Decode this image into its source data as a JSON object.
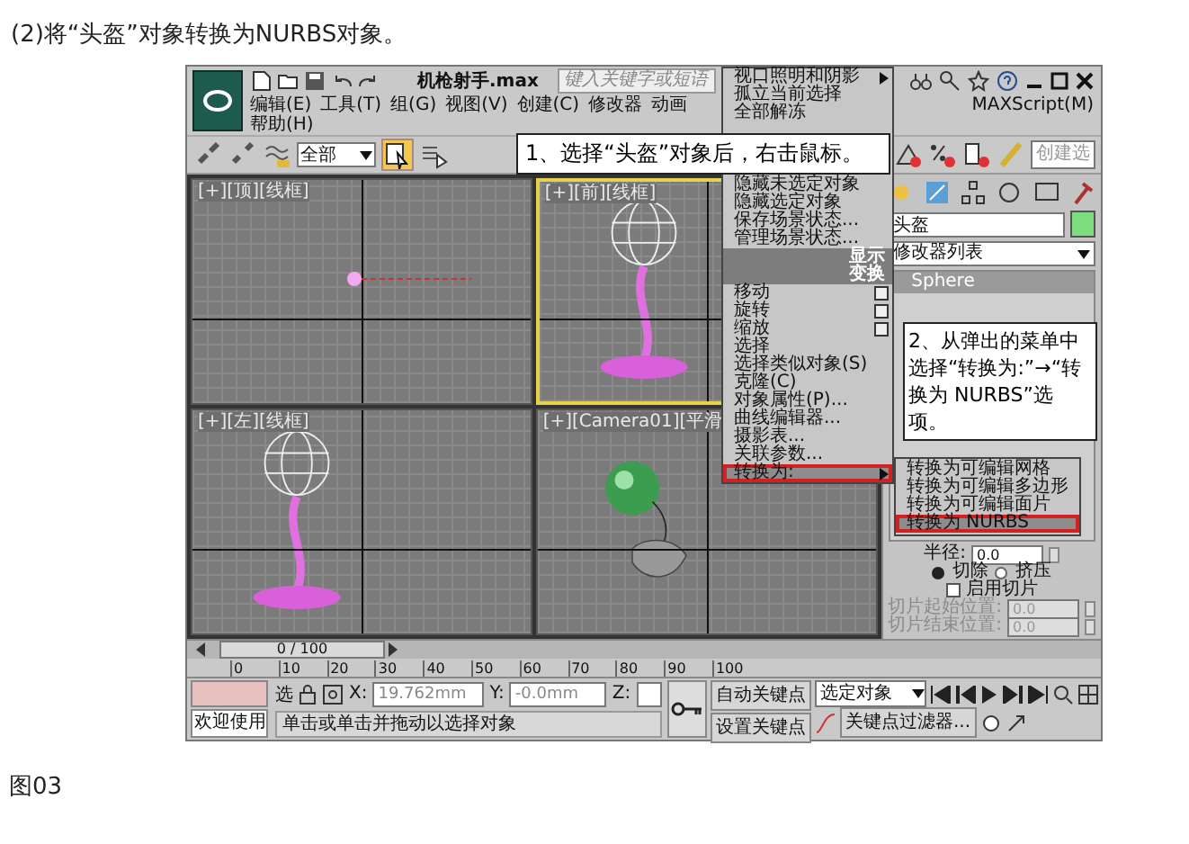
{
  "caption": "(2)将“头盔”对象转换为NURBS对象。",
  "window": {
    "title": "机枪射手.max",
    "search_placeholder": "键入关键字或短语"
  },
  "menu_bar": {
    "row_1_left": [
      "编辑(E)",
      "工具(T)",
      "组(G)",
      "视图(V)",
      "创建(C)",
      "修改器",
      "动画"
    ],
    "row_1_right": [
      "MAXScript(M)"
    ],
    "row_2": [
      "帮助(H)"
    ]
  },
  "toolbar": {
    "selection_filter": "全部",
    "named_selection": "创建选"
  },
  "viewports": [
    {
      "label": "[+][顶][线框]",
      "active": false,
      "kind": "marker"
    },
    {
      "label": "[+][前][线框]",
      "active": true,
      "kind": "plant"
    },
    {
      "label": "[+][左][线框]",
      "active": false,
      "kind": "plant"
    },
    {
      "label": "[+][Camera01][平滑",
      "active": false,
      "kind": "flower"
    }
  ],
  "command_panel": {
    "object_name": "头盔",
    "modifier_list": "修改器列表",
    "stack": [
      {
        "label": "Sphere",
        "selected": true
      }
    ],
    "radius_label": "半径:",
    "radius": "0.0",
    "radios": [
      {
        "label": "切除",
        "selected": true
      },
      {
        "label": "挤压",
        "selected": false
      }
    ],
    "slice_checkbox": {
      "label": "启用切片",
      "checked": false
    },
    "slice_fields": [
      {
        "label": "切片起始位置:",
        "value": "0.0",
        "disabled": true
      },
      {
        "label": "切片结束位置:",
        "value": "0.0",
        "disabled": true
      }
    ]
  },
  "quad_menu": {
    "upper": [
      {
        "kind": "item",
        "label": "视口照明和阴影",
        "submenu": true,
        "options_box": false,
        "selected": false
      },
      {
        "kind": "item",
        "label": "孤立当前选择",
        "submenu": false,
        "options_box": false,
        "selected": false
      },
      {
        "kind": "item",
        "label": "全部解冻",
        "submenu": false,
        "options_box": false,
        "selected": false
      }
    ],
    "lower": [
      {
        "kind": "item",
        "label": "隐藏未选定对象",
        "submenu": false,
        "options_box": false,
        "selected": false
      },
      {
        "kind": "item",
        "label": "隐藏选定对象",
        "submenu": false,
        "options_box": false,
        "selected": false
      },
      {
        "kind": "item",
        "label": "保存场景状态...",
        "submenu": false,
        "options_box": false,
        "selected": false
      },
      {
        "kind": "item",
        "label": "管理场景状态...",
        "submenu": false,
        "options_box": false,
        "selected": false
      },
      {
        "kind": "header",
        "label": "显示",
        "submenu": false,
        "options_box": false,
        "selected": false
      },
      {
        "kind": "header",
        "label": "变换",
        "submenu": false,
        "options_box": false,
        "selected": false
      },
      {
        "kind": "item",
        "label": "移动",
        "submenu": false,
        "options_box": true,
        "selected": false
      },
      {
        "kind": "item",
        "label": "旋转",
        "submenu": false,
        "options_box": true,
        "selected": false
      },
      {
        "kind": "item",
        "label": "缩放",
        "submenu": false,
        "options_box": true,
        "selected": false
      },
      {
        "kind": "item",
        "label": "选择",
        "submenu": false,
        "options_box": false,
        "selected": false
      },
      {
        "kind": "item",
        "label": "选择类似对象(S)",
        "submenu": false,
        "options_box": false,
        "selected": false
      },
      {
        "kind": "item",
        "label": "克隆(C)",
        "submenu": false,
        "options_box": false,
        "selected": false
      },
      {
        "kind": "item",
        "label": "对象属性(P)...",
        "submenu": false,
        "options_box": false,
        "selected": false
      },
      {
        "kind": "item",
        "label": "曲线编辑器...",
        "submenu": false,
        "options_box": false,
        "selected": false
      },
      {
        "kind": "item",
        "label": "摄影表...",
        "submenu": false,
        "options_box": false,
        "selected": false
      },
      {
        "kind": "item",
        "label": "关联参数...",
        "submenu": false,
        "options_box": false,
        "selected": false
      },
      {
        "kind": "item",
        "label": "转换为:",
        "submenu": true,
        "options_box": false,
        "selected": true
      }
    ]
  },
  "submenu": [
    {
      "label": "转换为可编辑网格",
      "selected": false
    },
    {
      "label": "转换为可编辑多边形",
      "selected": false
    },
    {
      "label": "转换为可编辑面片",
      "selected": false
    },
    {
      "label": "转换为 NURBS",
      "selected": true
    }
  ],
  "callouts": [
    "1、选择“头盔”对象后，右击鼠标。",
    "2、从弹出的菜单中选择“转换为:”→“转换为 NURBS”选项。"
  ],
  "timeline": {
    "frame": "0 / 100",
    "ticks": [
      "0",
      "10",
      "20",
      "30",
      "40",
      "50",
      "60",
      "70",
      "80",
      "90",
      "100"
    ]
  },
  "status": {
    "welcome": "欢迎使用",
    "lock_label": "选",
    "x_label": "X:",
    "x": "19.762mm",
    "y_label": "Y:",
    "y": "-0.0mm",
    "z_label": "Z:",
    "prompt": "单击或单击并拖动以选择对象",
    "auto_key": "自动关键点",
    "set_key": "设置关键点",
    "key_mode": "选定对象",
    "key_filters": "关键点过滤器..."
  },
  "figure_label": "图03"
}
